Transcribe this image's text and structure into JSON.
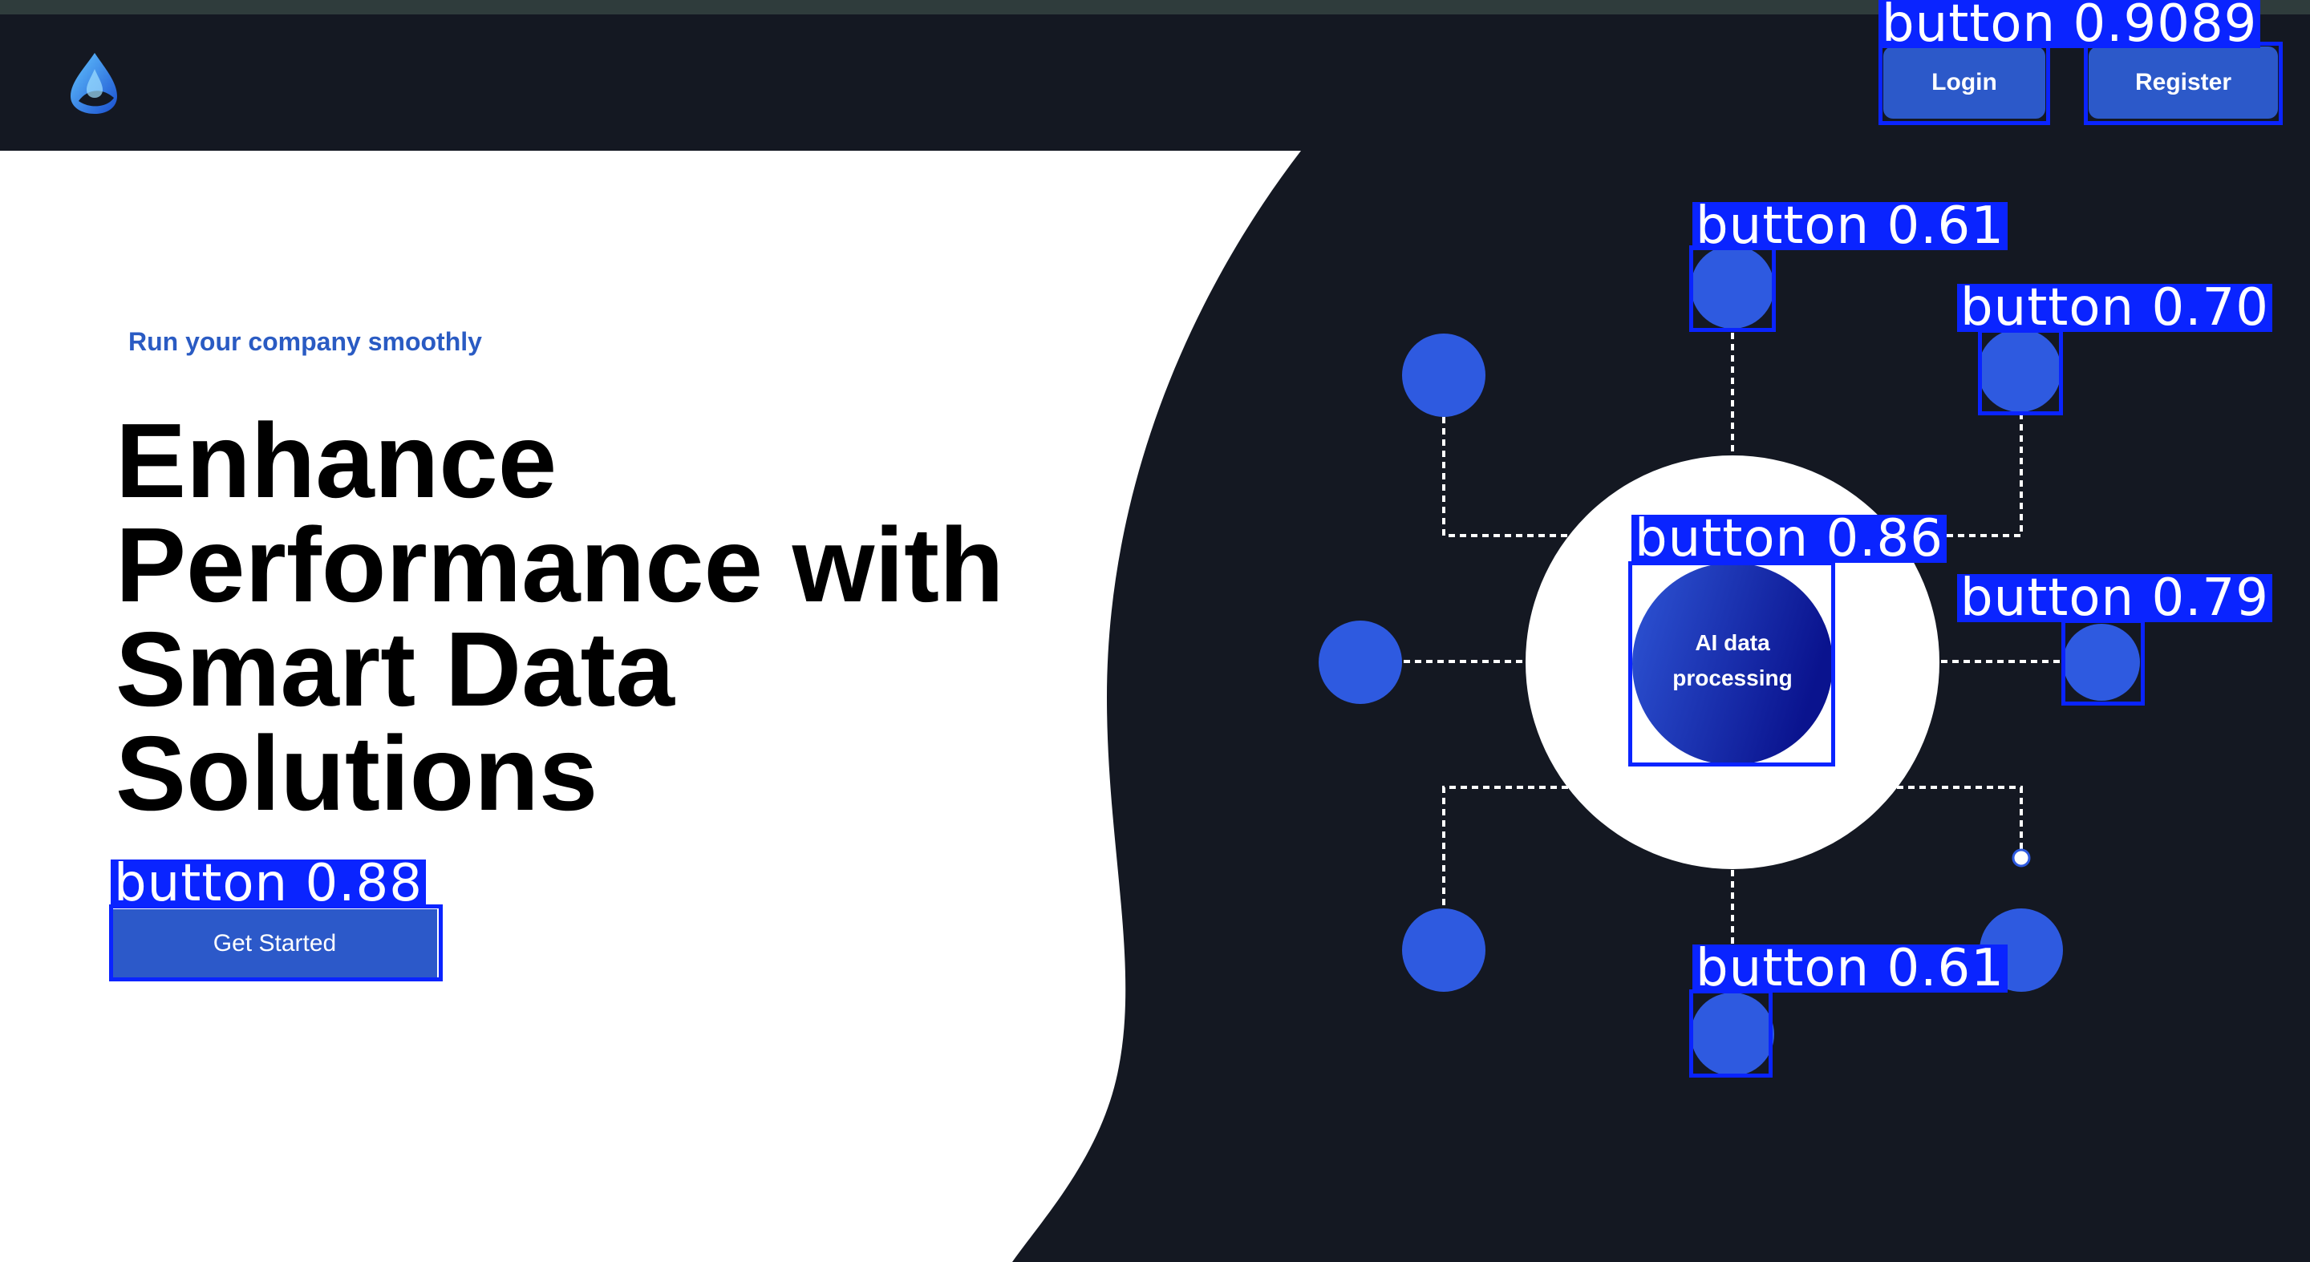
{
  "header": {
    "logo": "water-drop-logo",
    "login_label": "Login",
    "register_label": "Register"
  },
  "hero": {
    "eyebrow": "Run your company smoothly",
    "headline_lines": [
      "Enhance",
      "Performance with",
      "Smart Data",
      "Solutions"
    ],
    "cta_label": "Get Started"
  },
  "diagram": {
    "core_text_lines": [
      "AI data",
      "processing"
    ]
  },
  "detections": {
    "login_register": "button 0.9089",
    "node_top": "button 0.61",
    "node_top_right": "button 0.70",
    "core": "button 0.86",
    "node_right": "button 0.79",
    "node_bottom": "button 0.61",
    "cta": "button 0.88"
  },
  "colors": {
    "background": "#141822",
    "accent_blue": "#2c59c9",
    "node_blue": "#2e5ae0",
    "detection_blue": "#0a24ff",
    "core_gradient_start": "#2e55d6",
    "core_gradient_end": "#0a138e"
  }
}
